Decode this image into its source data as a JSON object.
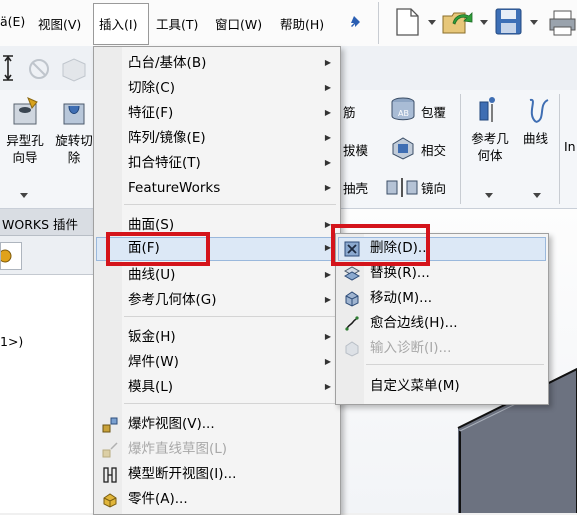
{
  "menubar": {
    "items": [
      "ä(E)",
      "视图(V)",
      "插入(I)",
      "工具(T)",
      "窗口(W)",
      "帮助(H)"
    ],
    "pin_icon": "pin-icon"
  },
  "ribbon": {
    "hole_wizard": "异型孔\n向导",
    "revolve_cut": "旋转切\n除",
    "rib": "筋",
    "wrap": "包覆",
    "draft": "拔模",
    "intersect": "相交",
    "shell": "抽壳",
    "mirror": "镜向",
    "ref_geometry": "参考几\n何体",
    "curves": "曲线",
    "partial": "In"
  },
  "tabstrip": {
    "label": "WORKS 插件"
  },
  "leftpanel": {
    "tree_text": "1>)"
  },
  "insert_menu": {
    "items": [
      {
        "label": "凸台/基体(B)",
        "submenu": true
      },
      {
        "label": "切除(C)",
        "submenu": true
      },
      {
        "label": "特征(F)",
        "submenu": true
      },
      {
        "label": "阵列/镜像(E)",
        "submenu": true
      },
      {
        "label": "扣合特征(T)",
        "submenu": true
      },
      {
        "label": "FeatureWorks",
        "submenu": true
      },
      {
        "label": "曲面(S)",
        "submenu": true
      },
      {
        "label": "面(F)",
        "submenu": true
      },
      {
        "label": "曲线(U)",
        "submenu": true
      },
      {
        "label": "参考几何体(G)",
        "submenu": true
      },
      {
        "label": "钣金(H)",
        "submenu": true
      },
      {
        "label": "焊件(W)",
        "submenu": true
      },
      {
        "label": "模具(L)",
        "submenu": true
      },
      {
        "label": "爆炸视图(V)...",
        "submenu": false
      },
      {
        "label": "爆炸直线草图(L)",
        "submenu": false
      },
      {
        "label": "模型断开视图(I)...",
        "submenu": false
      },
      {
        "label": "零件(A)...",
        "submenu": false
      }
    ]
  },
  "face_submenu": {
    "items": [
      {
        "label": "删除(D)..."
      },
      {
        "label": "替换(R)..."
      },
      {
        "label": "移动(M)..."
      },
      {
        "label": "愈合边线(H)..."
      },
      {
        "label": "输入诊断(I)..."
      },
      {
        "label": "自定义菜单(M)"
      }
    ]
  },
  "colors": {
    "highlight_box": "#d4141b",
    "menu_hover": "#dce8f6"
  }
}
